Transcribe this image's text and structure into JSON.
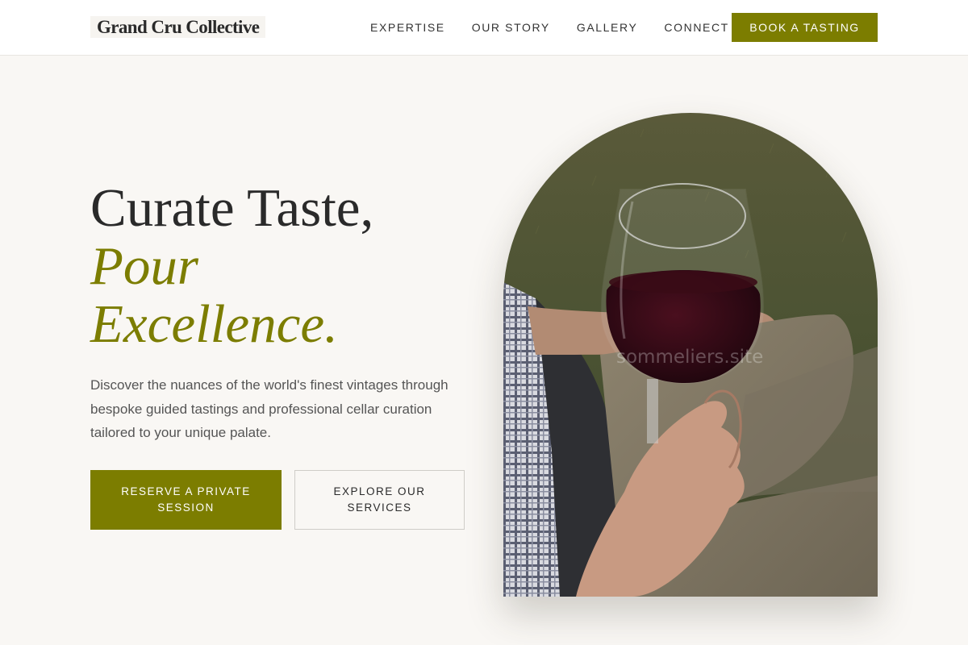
{
  "header": {
    "logo": "Grand Cru Collective",
    "nav": [
      {
        "label": "EXPERTISE"
      },
      {
        "label": "OUR STORY"
      },
      {
        "label": "GALLERY"
      },
      {
        "label": "CONNECT"
      }
    ],
    "cta_label": "BOOK A TASTING"
  },
  "hero": {
    "title_line1": "Curate Taste,",
    "title_line2": "Pour",
    "title_line3": "Excellence.",
    "description": "Discover the nuances of the world's finest vintages through bespoke guided tastings and professional cellar curation tailored to your unique palate.",
    "primary_button": "RESERVE A PRIVATE SESSION",
    "secondary_button": "EXPLORE OUR SERVICES",
    "image_watermark": "sommeliers.site"
  },
  "colors": {
    "accent": "#7c7d00",
    "background": "#f9f7f4",
    "header_bg": "#ffffff",
    "text": "#2a2a2a"
  }
}
